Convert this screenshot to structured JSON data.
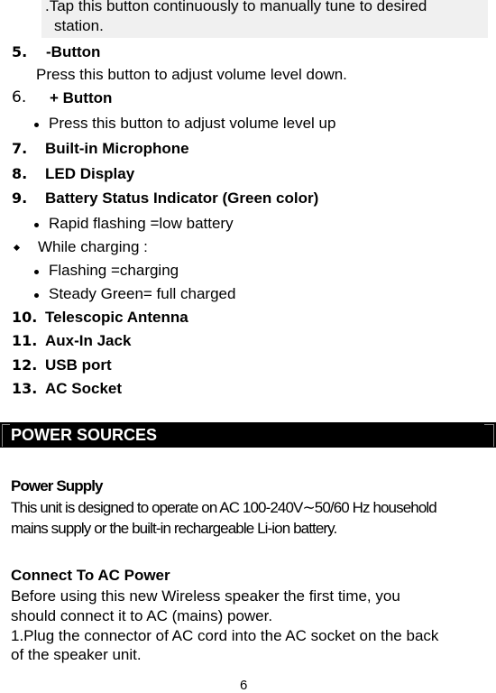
{
  "continued_desc": {
    "line1": ".Tap this button continuously to manually tune to desired",
    "line2": "station."
  },
  "items": [
    {
      "number": "5.",
      "title": "-Button",
      "desc": "Press this button to adjust volume level down."
    },
    {
      "number": "6.",
      "title": "+ Button",
      "bullets": [
        "Press this button to adjust volume level up"
      ]
    },
    {
      "number": "7.",
      "title": "Built-in Microphone"
    },
    {
      "number": "8.",
      "title": "LED Display"
    },
    {
      "number": "9.",
      "title": "Battery Status Indicator (Green color)",
      "bullets": [
        "Rapid flashing =low battery"
      ],
      "sub_heading": "While charging :",
      "sub_bullets": [
        "Flashing =charging",
        "Steady Green= full charged"
      ]
    },
    {
      "number": "10.",
      "title": "Telescopic Antenna"
    },
    {
      "number": "11.",
      "title": "Aux-In Jack"
    },
    {
      "number": "12.",
      "title": "USB port"
    },
    {
      "number": "13.",
      "title": "AC Socket"
    }
  ],
  "section": {
    "title": "POWER SOURCES"
  },
  "power_supply": {
    "heading": "Power Supply",
    "line1": "This unit is designed to operate on AC 100-240V∼50/60 Hz household",
    "line2": "mains supply or the built-in rechargeable Li-ion battery."
  },
  "connect_ac": {
    "heading": "Connect To AC Power",
    "lines": [
      "Before using this new Wireless speaker the first time, you",
      "should connect it to AC (mains) power.",
      "1.Plug the connector of AC cord into the AC socket on the back",
      "of the speaker unit."
    ]
  },
  "page_number": "6"
}
